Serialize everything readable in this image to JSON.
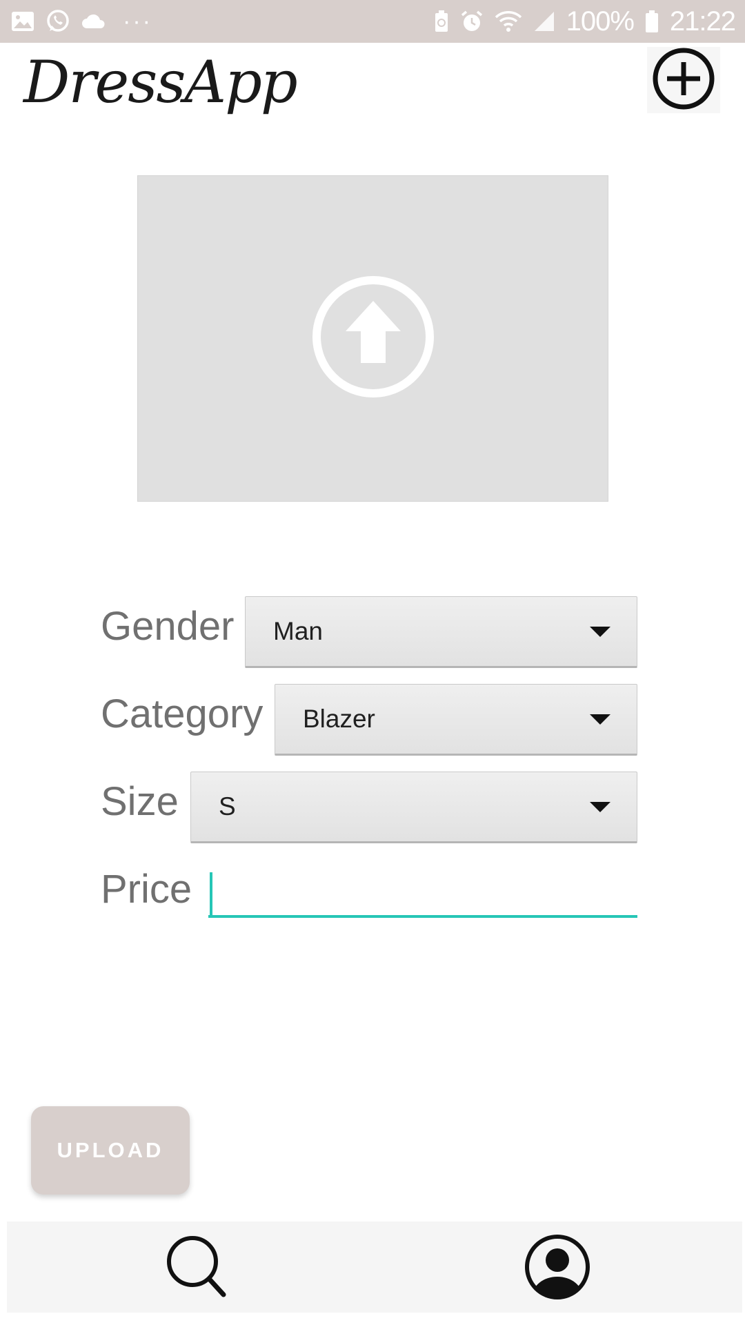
{
  "status_bar": {
    "battery_percent": "100%",
    "time": "21:22",
    "left_icons": [
      "gallery-icon",
      "whatsapp-icon",
      "cloud-icon",
      "more-dots-icon"
    ],
    "right_icons": [
      "battery-saver-icon",
      "alarm-icon",
      "wifi-icon",
      "signal-icon",
      "battery-icon"
    ],
    "more_dots": "···"
  },
  "header": {
    "app_name": "DressApp",
    "add_icon": "plus-circle-icon"
  },
  "image_upload": {
    "icon": "upload-arrow-icon"
  },
  "form": {
    "gender": {
      "label": "Gender",
      "value": "Man"
    },
    "category": {
      "label": "Category",
      "value": "Blazer"
    },
    "size": {
      "label": "Size",
      "value": "S"
    },
    "price": {
      "label": "Price",
      "value": ""
    }
  },
  "upload_button": {
    "label": "UPLOAD"
  },
  "bottom_nav": {
    "items": [
      {
        "icon": "search-icon"
      },
      {
        "icon": "profile-icon"
      }
    ]
  },
  "colors": {
    "status_bar": "#d8cfcc",
    "upload_button": "#d8cfcc",
    "accent": "#26c6b6",
    "placeholder_bg": "#e0e0e0",
    "label_text": "#707070"
  }
}
